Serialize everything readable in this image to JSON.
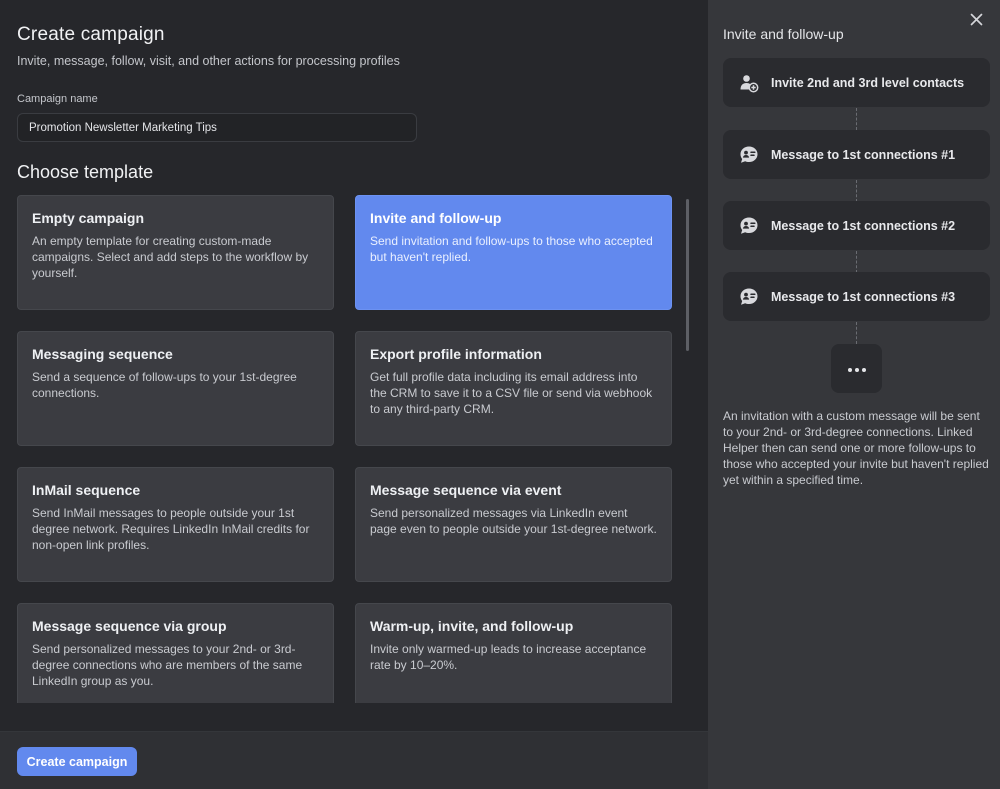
{
  "header": {
    "title": "Create campaign",
    "subtitle": "Invite, message, follow, visit, and other actions for processing profiles"
  },
  "campaign_name": {
    "label": "Campaign name",
    "value": "Promotion Newsletter Marketing Tips"
  },
  "templates": {
    "title": "Choose template",
    "items": [
      {
        "title": "Empty campaign",
        "desc": "An empty template for creating custom-made campaigns. Select and add steps to the workflow by yourself."
      },
      {
        "title": "Invite and follow-up",
        "desc": "Send invitation and follow-ups to those who accepted but haven't replied."
      },
      {
        "title": "Messaging sequence",
        "desc": "Send a sequence of follow-ups to your 1st-degree connections."
      },
      {
        "title": "Export profile information",
        "desc": "Get full profile data including its email address into the CRM to save it to a CSV file or send via webhook to any third-party CRM."
      },
      {
        "title": "InMail sequence",
        "desc": "Send InMail messages to people outside your 1st degree network. Requires LinkedIn InMail credits for non-open link profiles."
      },
      {
        "title": "Message sequence via event",
        "desc": "Send personalized messages via LinkedIn event page even to people outside your 1st-degree network."
      },
      {
        "title": "Message sequence via group",
        "desc": "Send personalized messages to your 2nd- or 3rd-degree connections who are members of the same LinkedIn group as you."
      },
      {
        "title": "Warm-up, invite, and follow-up",
        "desc": "Invite only warmed-up leads to increase acceptance rate by 10–20%."
      }
    ],
    "selected_index": 1
  },
  "footer": {
    "create_label": "Create campaign"
  },
  "preview": {
    "title": "Invite and follow-up",
    "steps": [
      {
        "label": "Invite 2nd and 3rd level contacts",
        "icon": "add-person-icon"
      },
      {
        "label": "Message to 1st connections #1",
        "icon": "message-person-icon"
      },
      {
        "label": "Message to 1st connections #2",
        "icon": "message-person-icon"
      },
      {
        "label": "Message to 1st connections #3",
        "icon": "message-person-icon"
      }
    ],
    "more_icon": "more-dots-icon",
    "description": "An invitation with a custom message will be sent to your 2nd- or 3rd-degree connections. Linked Helper then can send one or more follow-ups to those who accepted your invite but haven't replied yet within a specified time."
  },
  "colors": {
    "accent": "#6289ee",
    "background": "#26272b",
    "panel": "#36373b",
    "card": "#3b3c41"
  }
}
